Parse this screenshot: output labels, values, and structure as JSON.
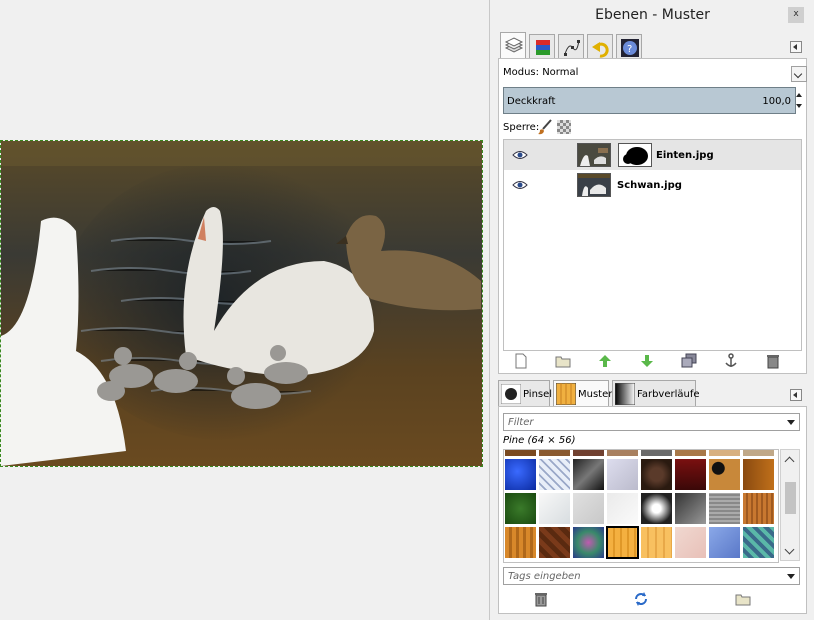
{
  "window": {
    "title": "Ebenen - Muster",
    "close_label": "x"
  },
  "dock_tabs": [
    {
      "name": "layers",
      "icon": "layers-icon"
    },
    {
      "name": "channels",
      "icon": "channels-icon"
    },
    {
      "name": "paths",
      "icon": "paths-icon"
    },
    {
      "name": "undo-history",
      "icon": "undo-history-icon"
    },
    {
      "name": "help",
      "icon": "help-icon"
    }
  ],
  "layers_panel": {
    "mode_label": "Modus:",
    "mode_value": "Normal",
    "opacity_label": "Deckkraft",
    "opacity_value": "100,0",
    "lock_label": "Sperre:",
    "layers": [
      {
        "name": "Einten.jpg",
        "selected": true,
        "has_mask": true
      },
      {
        "name": "Schwan.jpg",
        "selected": false,
        "has_mask": false
      }
    ],
    "actions": [
      "new-layer",
      "new-layer-group",
      "raise-layer",
      "lower-layer",
      "duplicate-layer",
      "anchor-layer",
      "delete-layer"
    ]
  },
  "pattern_panel": {
    "tabs": [
      {
        "label": "Pinsel",
        "icon": "brush-preview-icon"
      },
      {
        "label": "Muster",
        "icon": "pattern-preview-icon"
      },
      {
        "label": "Farbverläufe",
        "icon": "gradient-preview-icon"
      }
    ],
    "filter_placeholder": "Filter",
    "selected_pattern": "Pine (64 × 56)",
    "tags_placeholder": "Tags eingeben",
    "actions": [
      "delete-pattern",
      "refresh-patterns",
      "open-folder"
    ]
  },
  "colors": {
    "accent_green": "#3a8a20",
    "opacity_bar": "#b8c8d3"
  }
}
